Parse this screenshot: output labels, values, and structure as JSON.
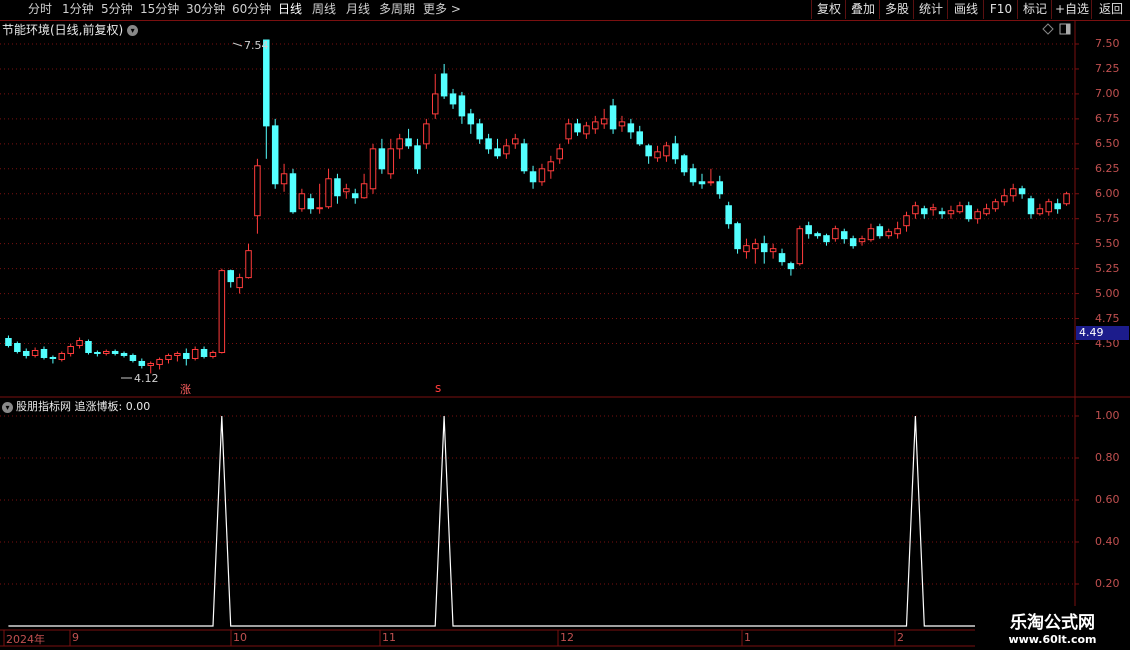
{
  "toolbar": {
    "periods": [
      "分时",
      "1分钟",
      "5分钟",
      "15分钟",
      "30分钟",
      "60分钟",
      "日线",
      "周线",
      "月线",
      "多周期",
      "更多 >"
    ],
    "active_period": "日线",
    "right_buttons": [
      "复权",
      "叠加",
      "多股",
      "统计",
      "画线",
      "F10",
      "标记",
      "+自选",
      "返回"
    ]
  },
  "main_panel": {
    "title": "节能环境(日线,前复权)",
    "current_price_tag": "4.49",
    "high_label": "7.54",
    "low_label": "4.12",
    "signal_marker_zhang": "涨",
    "signal_marker_s": "s",
    "y_axis_labels": [
      "7.50",
      "7.25",
      "7.00",
      "6.75",
      "6.50",
      "6.25",
      "6.00",
      "5.75",
      "5.50",
      "5.25",
      "5.00",
      "4.75",
      "4.50"
    ]
  },
  "indicator_panel": {
    "title": "股朋指标网 追涨博板: 0.00",
    "y_axis_labels": [
      "1.00",
      "0.80",
      "0.60",
      "0.40",
      "0.20"
    ]
  },
  "x_axis": {
    "labels": [
      "2024年",
      "9",
      "10",
      "11",
      "12",
      "1",
      "2"
    ]
  },
  "watermark": {
    "title": "乐淘公式网",
    "url": "www.60lt.com"
  },
  "colors": {
    "up": "#ff3c3c",
    "down": "#54ffff",
    "grid": "#7a1010",
    "axis_text": "#c05050",
    "indicator_line": "#ffffff"
  },
  "chart_data": [
    {
      "type": "candlestick",
      "ylim": [
        4.1,
        7.6
      ],
      "candles": [
        [
          4.55,
          4.48,
          4.58,
          4.46
        ],
        [
          4.5,
          4.42,
          4.52,
          4.4
        ],
        [
          4.42,
          4.38,
          4.45,
          4.35
        ],
        [
          4.38,
          4.43,
          4.46,
          4.36
        ],
        [
          4.44,
          4.36,
          4.47,
          4.34
        ],
        [
          4.36,
          4.35,
          4.38,
          4.3
        ],
        [
          4.34,
          4.4,
          4.42,
          4.32
        ],
        [
          4.4,
          4.47,
          4.5,
          4.37
        ],
        [
          4.48,
          4.53,
          4.56,
          4.45
        ],
        [
          4.52,
          4.41,
          4.54,
          4.39
        ],
        [
          4.41,
          4.4,
          4.43,
          4.37
        ],
        [
          4.4,
          4.42,
          4.44,
          4.38
        ],
        [
          4.42,
          4.4,
          4.44,
          4.38
        ],
        [
          4.4,
          4.38,
          4.42,
          4.36
        ],
        [
          4.38,
          4.33,
          4.4,
          4.31
        ],
        [
          4.32,
          4.28,
          4.35,
          4.25
        ],
        [
          4.28,
          4.3,
          4.32,
          4.2
        ],
        [
          4.29,
          4.34,
          4.36,
          4.24
        ],
        [
          4.34,
          4.38,
          4.4,
          4.3
        ],
        [
          4.38,
          4.4,
          4.42,
          4.32
        ],
        [
          4.4,
          4.35,
          4.45,
          4.28
        ],
        [
          4.35,
          4.44,
          4.47,
          4.33
        ],
        [
          4.44,
          4.37,
          4.47,
          4.35
        ],
        [
          4.37,
          4.41,
          4.43,
          4.35
        ],
        [
          4.41,
          5.23,
          5.25,
          4.4
        ],
        [
          5.23,
          5.12,
          5.24,
          5.06
        ],
        [
          5.06,
          5.16,
          5.2,
          5.0
        ],
        [
          5.16,
          5.43,
          5.5,
          5.15
        ],
        [
          5.78,
          6.28,
          6.35,
          5.6
        ],
        [
          7.54,
          6.68,
          7.54,
          6.35
        ],
        [
          6.68,
          6.1,
          6.75,
          6.05
        ],
        [
          6.1,
          6.2,
          6.3,
          6.02
        ],
        [
          6.2,
          5.82,
          6.25,
          5.8
        ],
        [
          5.85,
          6.0,
          6.05,
          5.82
        ],
        [
          5.95,
          5.85,
          6.0,
          5.8
        ],
        [
          5.85,
          5.86,
          6.1,
          5.8
        ],
        [
          5.87,
          6.15,
          6.25,
          5.85
        ],
        [
          6.15,
          5.98,
          6.2,
          5.9
        ],
        [
          6.02,
          6.05,
          6.1,
          5.95
        ],
        [
          6.0,
          5.96,
          6.05,
          5.9
        ],
        [
          5.96,
          6.1,
          6.2,
          5.95
        ],
        [
          6.05,
          6.45,
          6.5,
          6.0
        ],
        [
          6.45,
          6.25,
          6.55,
          6.2
        ],
        [
          6.2,
          6.45,
          6.55,
          6.15
        ],
        [
          6.45,
          6.55,
          6.6,
          6.35
        ],
        [
          6.55,
          6.48,
          6.65,
          6.45
        ],
        [
          6.48,
          6.25,
          6.55,
          6.2
        ],
        [
          6.5,
          6.7,
          6.75,
          6.45
        ],
        [
          6.8,
          7.0,
          7.2,
          6.75
        ],
        [
          7.2,
          6.98,
          7.3,
          6.95
        ],
        [
          7.0,
          6.9,
          7.05,
          6.85
        ],
        [
          6.98,
          6.78,
          7.02,
          6.7
        ],
        [
          6.8,
          6.7,
          6.85,
          6.6
        ],
        [
          6.7,
          6.55,
          6.75,
          6.5
        ],
        [
          6.55,
          6.45,
          6.6,
          6.4
        ],
        [
          6.45,
          6.38,
          6.55,
          6.35
        ],
        [
          6.4,
          6.48,
          6.55,
          6.35
        ],
        [
          6.5,
          6.55,
          6.6,
          6.45
        ],
        [
          6.5,
          6.23,
          6.55,
          6.2
        ],
        [
          6.22,
          6.12,
          6.28,
          6.05
        ],
        [
          6.12,
          6.25,
          6.3,
          6.08
        ],
        [
          6.23,
          6.32,
          6.38,
          6.15
        ],
        [
          6.35,
          6.45,
          6.5,
          6.3
        ],
        [
          6.55,
          6.7,
          6.75,
          6.5
        ],
        [
          6.7,
          6.62,
          6.75,
          6.58
        ],
        [
          6.6,
          6.68,
          6.72,
          6.55
        ],
        [
          6.65,
          6.72,
          6.78,
          6.6
        ],
        [
          6.7,
          6.75,
          6.85,
          6.65
        ],
        [
          6.88,
          6.65,
          6.95,
          6.6
        ],
        [
          6.68,
          6.72,
          6.78,
          6.62
        ],
        [
          6.7,
          6.62,
          6.75,
          6.55
        ],
        [
          6.62,
          6.5,
          6.68,
          6.48
        ],
        [
          6.48,
          6.38,
          6.5,
          6.3
        ],
        [
          6.36,
          6.42,
          6.48,
          6.32
        ],
        [
          6.38,
          6.48,
          6.52,
          6.32
        ],
        [
          6.5,
          6.35,
          6.58,
          6.3
        ],
        [
          6.38,
          6.22,
          6.4,
          6.18
        ],
        [
          6.25,
          6.12,
          6.3,
          6.08
        ],
        [
          6.12,
          6.1,
          6.2,
          6.05
        ],
        [
          6.12,
          6.12,
          6.25,
          6.08
        ],
        [
          6.12,
          6.0,
          6.18,
          5.95
        ],
        [
          5.88,
          5.7,
          5.92,
          5.65
        ],
        [
          5.7,
          5.45,
          5.72,
          5.4
        ],
        [
          5.42,
          5.48,
          5.55,
          5.35
        ],
        [
          5.45,
          5.5,
          5.55,
          5.3
        ],
        [
          5.5,
          5.42,
          5.58,
          5.3
        ],
        [
          5.42,
          5.45,
          5.5,
          5.35
        ],
        [
          5.4,
          5.32,
          5.45,
          5.28
        ],
        [
          5.3,
          5.25,
          5.32,
          5.18
        ],
        [
          5.3,
          5.65,
          5.68,
          5.28
        ],
        [
          5.68,
          5.6,
          5.72,
          5.55
        ],
        [
          5.6,
          5.58,
          5.62,
          5.55
        ],
        [
          5.58,
          5.52,
          5.6,
          5.48
        ],
        [
          5.55,
          5.65,
          5.68,
          5.52
        ],
        [
          5.62,
          5.55,
          5.65,
          5.5
        ],
        [
          5.55,
          5.48,
          5.58,
          5.45
        ],
        [
          5.52,
          5.55,
          5.58,
          5.48
        ],
        [
          5.54,
          5.65,
          5.7,
          5.52
        ],
        [
          5.67,
          5.58,
          5.7,
          5.55
        ],
        [
          5.58,
          5.62,
          5.65,
          5.55
        ],
        [
          5.6,
          5.65,
          5.72,
          5.55
        ],
        [
          5.68,
          5.78,
          5.82,
          5.62
        ],
        [
          5.8,
          5.88,
          5.92,
          5.75
        ],
        [
          5.85,
          5.8,
          5.88,
          5.75
        ],
        [
          5.84,
          5.86,
          5.9,
          5.78
        ],
        [
          5.82,
          5.8,
          5.86,
          5.75
        ],
        [
          5.8,
          5.83,
          5.88,
          5.75
        ],
        [
          5.82,
          5.88,
          5.92,
          5.8
        ],
        [
          5.88,
          5.75,
          5.92,
          5.72
        ],
        [
          5.75,
          5.82,
          5.85,
          5.7
        ],
        [
          5.8,
          5.85,
          5.9,
          5.78
        ],
        [
          5.85,
          5.92,
          5.95,
          5.82
        ],
        [
          5.92,
          5.98,
          6.05,
          5.88
        ],
        [
          5.98,
          6.05,
          6.1,
          5.92
        ],
        [
          6.05,
          6.0,
          6.08,
          5.95
        ],
        [
          5.95,
          5.8,
          5.98,
          5.75
        ],
        [
          5.8,
          5.85,
          5.9,
          5.78
        ],
        [
          5.82,
          5.92,
          5.95,
          5.78
        ],
        [
          5.9,
          5.85,
          5.95,
          5.8
        ],
        [
          5.9,
          6.0,
          6.02,
          5.88
        ]
      ]
    },
    {
      "type": "line",
      "name": "追涨博板",
      "ylim": [
        0,
        1.05
      ],
      "spike_indices": [
        24,
        49,
        102
      ],
      "values": [
        0,
        0,
        0,
        0,
        0,
        0,
        0,
        0,
        0,
        0,
        0,
        0,
        0,
        0,
        0,
        0,
        0,
        0,
        0,
        0,
        0,
        0,
        0,
        0,
        1,
        0,
        0,
        0,
        0,
        0,
        0,
        0,
        0,
        0,
        0,
        0,
        0,
        0,
        0,
        0,
        0,
        0,
        0,
        0,
        0,
        0,
        0,
        0,
        0,
        1,
        0,
        0,
        0,
        0,
        0,
        0,
        0,
        0,
        0,
        0,
        0,
        0,
        0,
        0,
        0,
        0,
        0,
        0,
        0,
        0,
        0,
        0,
        0,
        0,
        0,
        0,
        0,
        0,
        0,
        0,
        0,
        0,
        0,
        0,
        0,
        0,
        0,
        0,
        0,
        0,
        0,
        0,
        0,
        0,
        0,
        0,
        0,
        0,
        0,
        0,
        0,
        0,
        1,
        0,
        0,
        0,
        0,
        0,
        0,
        0,
        0,
        0,
        0,
        0,
        0,
        0,
        0,
        0,
        0,
        0,
        0,
        0,
        0,
        0,
        0,
        0
      ]
    }
  ]
}
